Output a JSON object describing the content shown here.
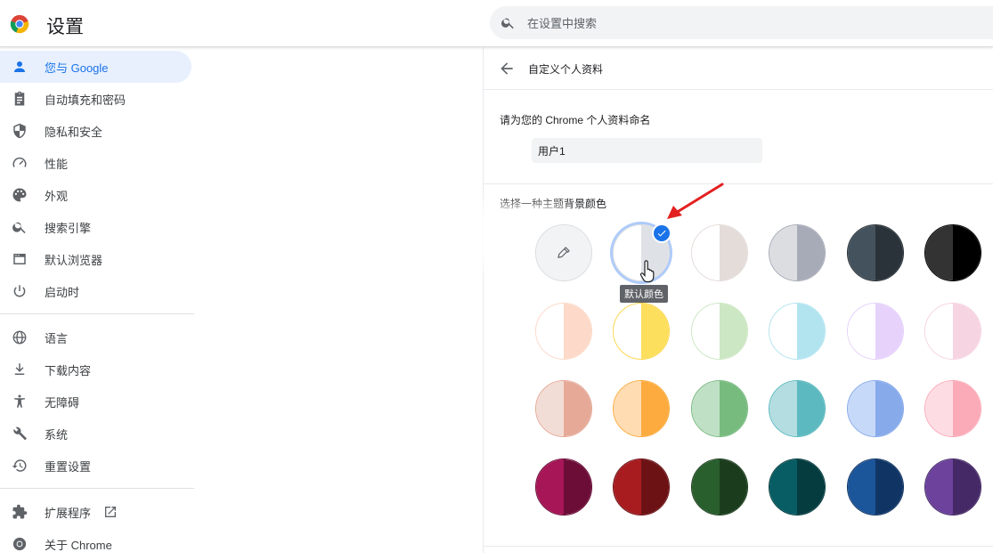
{
  "header": {
    "title": "设置",
    "search_placeholder": "在设置中搜索"
  },
  "sidebar": {
    "items": [
      {
        "label": "您与 Google",
        "icon": "person-icon",
        "active": true
      },
      {
        "label": "自动填充和密码",
        "icon": "clipboard-icon"
      },
      {
        "label": "隐私和安全",
        "icon": "shield-icon"
      },
      {
        "label": "性能",
        "icon": "speedometer-icon"
      },
      {
        "label": "外观",
        "icon": "palette-icon"
      },
      {
        "label": "搜索引擎",
        "icon": "search-icon"
      },
      {
        "label": "默认浏览器",
        "icon": "browser-icon"
      },
      {
        "label": "启动时",
        "icon": "power-icon"
      },
      {
        "label": "语言",
        "icon": "globe-icon"
      },
      {
        "label": "下载内容",
        "icon": "download-icon"
      },
      {
        "label": "无障碍",
        "icon": "accessibility-icon"
      },
      {
        "label": "系统",
        "icon": "wrench-icon"
      },
      {
        "label": "重置设置",
        "icon": "restore-icon"
      },
      {
        "label": "扩展程序",
        "icon": "puzzle-icon"
      },
      {
        "label": "关于 Chrome",
        "icon": "chrome-icon"
      }
    ]
  },
  "panel": {
    "subpage_title": "自定义个人资料",
    "name_label": "请为您的 Chrome 个人资料命名",
    "name_value": "用户1",
    "color_label": "选择一种主题背景颜色",
    "tooltip": "默认颜色",
    "colors": [
      {
        "left": "#f1f3f4",
        "right": "#f1f3f4",
        "border": "#dadce0",
        "type": "picker"
      },
      {
        "left": "#ffffff",
        "right": "#dee1e6",
        "border": "#dadce0",
        "selected": true
      },
      {
        "left": "#ffffff",
        "right": "#e3dcd9",
        "border": "#e3dcd9"
      },
      {
        "left": "#dcdde1",
        "right": "#a7abb7",
        "border": "#a7abb7"
      },
      {
        "left": "#44525e",
        "right": "#2a3339",
        "border": "#2a3339"
      },
      {
        "left": "#333333",
        "right": "#000000",
        "border": "#000000"
      },
      {
        "left": "#ffffff",
        "right": "#fcd9c8",
        "border": "#fcd9c8"
      },
      {
        "left": "#ffffff",
        "right": "#fddf5e",
        "border": "#fbd64b"
      },
      {
        "left": "#ffffff",
        "right": "#cce7c3",
        "border": "#cce7c3"
      },
      {
        "left": "#ffffff",
        "right": "#b1e4ef",
        "border": "#b1e4ef"
      },
      {
        "left": "#ffffff",
        "right": "#e6d2fb",
        "border": "#e6d2fb"
      },
      {
        "left": "#ffffff",
        "right": "#f6d4e2",
        "border": "#f6d4e2"
      },
      {
        "left": "#f2ddd6",
        "right": "#e6a997",
        "border": "#e6a997"
      },
      {
        "left": "#ffdcb2",
        "right": "#fdab3f",
        "border": "#fdab3f"
      },
      {
        "left": "#c0e0c5",
        "right": "#77bb7f",
        "border": "#77bb7f"
      },
      {
        "left": "#b3dde0",
        "right": "#5bb9bf",
        "border": "#5bb9bf"
      },
      {
        "left": "#c6d9f8",
        "right": "#86aaea",
        "border": "#86aaea"
      },
      {
        "left": "#fddde3",
        "right": "#fbaab7",
        "border": "#fbaab7"
      },
      {
        "left": "#a71656",
        "right": "#6c0d38",
        "border": "#6c0d38"
      },
      {
        "left": "#a81c20",
        "right": "#6c1215",
        "border": "#6c1215"
      },
      {
        "left": "#295e2d",
        "right": "#1b3d1d",
        "border": "#1b3d1d"
      },
      {
        "left": "#075d63",
        "right": "#053c40",
        "border": "#053c40"
      },
      {
        "left": "#1b559a",
        "right": "#103565",
        "border": "#103565"
      },
      {
        "left": "#6c429d",
        "right": "#452966",
        "border": "#452966"
      }
    ]
  },
  "colors": {
    "accent": "#1a73e8",
    "active_nav_bg": "#e8f0fe",
    "annotation_arrow": "#e32020"
  }
}
